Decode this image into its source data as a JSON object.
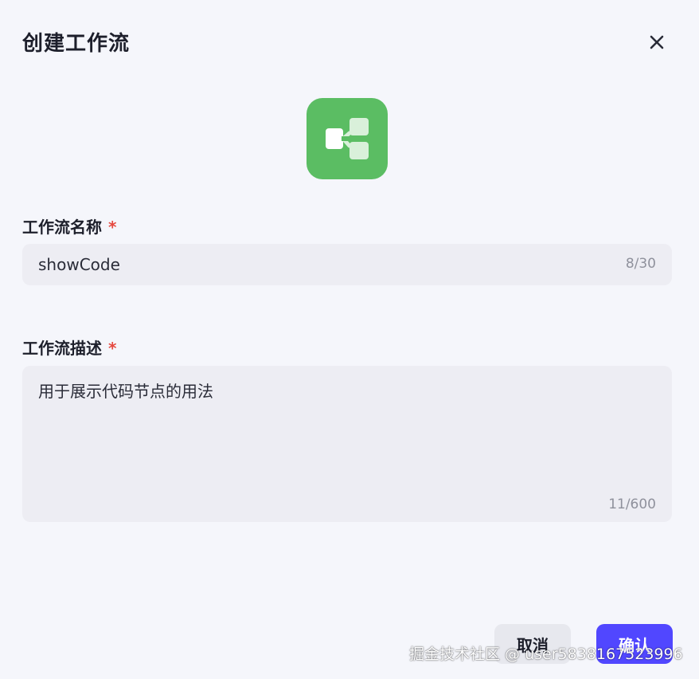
{
  "dialog": {
    "title": "创建工作流",
    "close_icon": "close-icon",
    "workflow_icon": "workflow-icon",
    "accent_color": "#5bbd63"
  },
  "name_field": {
    "label": "工作流名称",
    "required_mark": "*",
    "value": "showCode",
    "counter": "8/30"
  },
  "desc_field": {
    "label": "工作流描述",
    "required_mark": "*",
    "value": "用于展示代码节点的用法",
    "counter": "11/600"
  },
  "footer": {
    "cancel_label": "取消",
    "confirm_label": "确认",
    "confirm_color": "#5147ff"
  },
  "watermark": "掘金技术社区 @ user5838167523996"
}
